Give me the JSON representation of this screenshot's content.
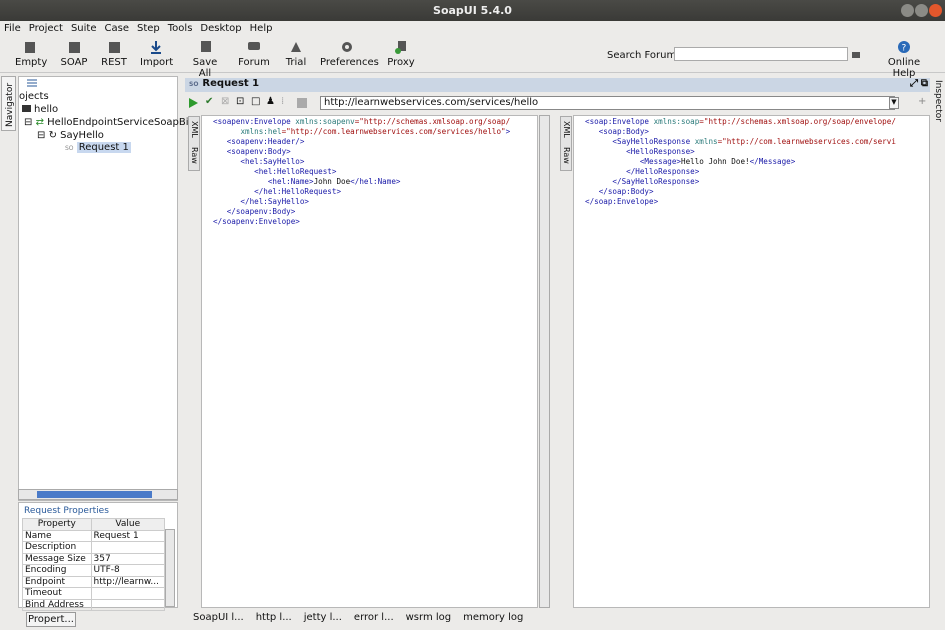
{
  "window": {
    "title": "SoapUI 5.4.0"
  },
  "menu": [
    "File",
    "Project",
    "Suite",
    "Case",
    "Step",
    "Tools",
    "Desktop",
    "Help"
  ],
  "toolbar": {
    "empty": "Empty",
    "soap": "SOAP",
    "rest": "REST",
    "import": "Import",
    "save_all": "Save All",
    "forum": "Forum",
    "trial": "Trial",
    "preferences": "Preferences",
    "proxy": "Proxy",
    "search_label": "Search Forum",
    "online_help": "Online Help"
  },
  "navigator": {
    "tab": "Navigator",
    "root": "ojects",
    "project": "hello",
    "interface": "HelloEndpointServiceSoapBin",
    "operation": "SayHello",
    "request": "Request 1"
  },
  "properties": {
    "title": "Request Properties",
    "col_property": "Property",
    "col_value": "Value",
    "rows": [
      [
        "Name",
        "Request 1"
      ],
      [
        "Description",
        ""
      ],
      [
        "Message Size",
        "357"
      ],
      [
        "Encoding",
        "UTF-8"
      ],
      [
        "Endpoint",
        "http://learnw..."
      ],
      [
        "Timeout",
        ""
      ],
      [
        "Bind Address",
        ""
      ]
    ],
    "button": "Propert..."
  },
  "request": {
    "title": "Request 1",
    "url": "http://learnwebservices.com/services/hello"
  },
  "editor_tabs": {
    "xml": "XML",
    "raw": "Raw"
  },
  "request_xml": [
    {
      "t": "<soapenv:Envelope ",
      "a": "xmlns:soapenv",
      "v": "\"http://schemas.xmlsoap.org/soap/"
    },
    {
      "t": "      ",
      "a": "xmlns:hel",
      "v": "\"http://com.learnwebservices.com/services/hello\"",
      "e": ">"
    },
    {
      "t": "   <soapenv:Header/>"
    },
    {
      "t": "   <soapenv:Body>"
    },
    {
      "t": "      <hel:SayHello>"
    },
    {
      "t": "         <hel:HelloRequest>"
    },
    {
      "t": "            <hel:Name>",
      "x": "John Doe",
      "c": "</hel:Name>"
    },
    {
      "t": "         </hel:HelloRequest>"
    },
    {
      "t": "      </hel:SayHello>"
    },
    {
      "t": "   </soapenv:Body>"
    },
    {
      "t": "</soapenv:Envelope>"
    }
  ],
  "response_xml": [
    {
      "t": "<soap:Envelope ",
      "a": "xmlns:soap",
      "v": "\"http://schemas.xmlsoap.org/soap/envelope/"
    },
    {
      "t": "   <soap:Body>"
    },
    {
      "t": "      <SayHelloResponse ",
      "a": "xmlns",
      "v": "\"http://com.learnwebservices.com/servi"
    },
    {
      "t": "         <HelloResponse>"
    },
    {
      "t": "            <Message>",
      "x": "Hello John Doe!",
      "c": "</Message>"
    },
    {
      "t": "         </HelloResponse>"
    },
    {
      "t": "      </SayHelloResponse>"
    },
    {
      "t": "   </soap:Body>"
    },
    {
      "t": "</soap:Envelope>"
    }
  ],
  "bottom_tabs": [
    "SoapUI l...",
    "http l...",
    "jetty l...",
    "error l...",
    "wsrm log",
    "memory log"
  ],
  "inspector": "Inspector"
}
